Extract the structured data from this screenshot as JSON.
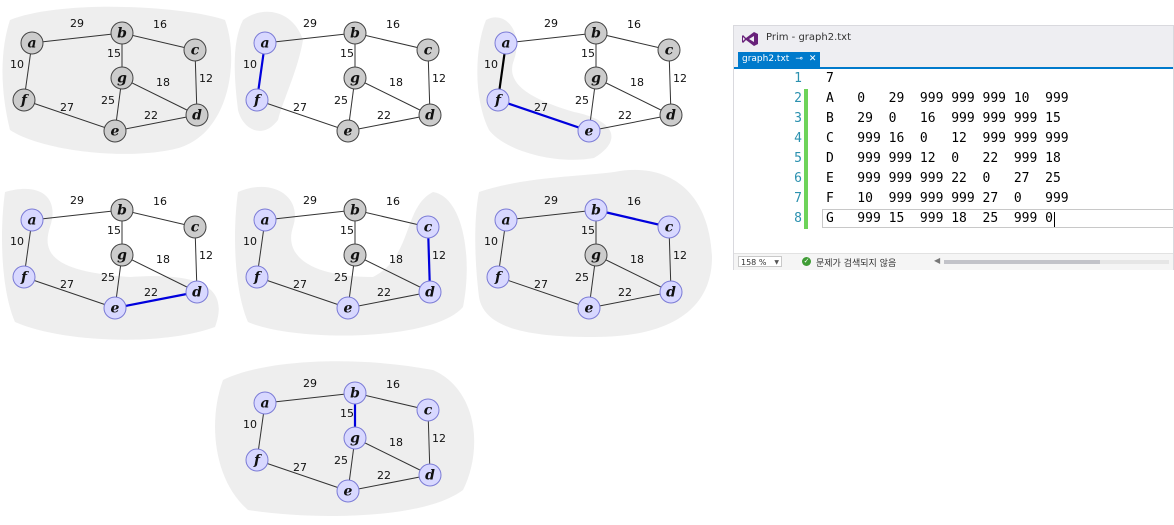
{
  "nodes": [
    {
      "id": "a",
      "label": "a"
    },
    {
      "id": "b",
      "label": "b"
    },
    {
      "id": "c",
      "label": "c"
    },
    {
      "id": "g",
      "label": "g"
    },
    {
      "id": "f",
      "label": "f"
    },
    {
      "id": "e",
      "label": "e"
    },
    {
      "id": "d",
      "label": "d"
    }
  ],
  "edges": [
    {
      "u": "a",
      "v": "b",
      "w": "29"
    },
    {
      "u": "b",
      "v": "c",
      "w": "16"
    },
    {
      "u": "a",
      "v": "f",
      "w": "10"
    },
    {
      "u": "b",
      "v": "g",
      "w": "15"
    },
    {
      "u": "g",
      "v": "d",
      "w": "18"
    },
    {
      "u": "c",
      "v": "d",
      "w": "12"
    },
    {
      "u": "f",
      "v": "e",
      "w": "27"
    },
    {
      "u": "g",
      "v": "e",
      "w": "25"
    },
    {
      "u": "e",
      "v": "d",
      "w": "22"
    }
  ],
  "steps": [
    {
      "visited": [],
      "blue_edges": [],
      "black_edges": []
    },
    {
      "visited": [
        "a",
        "f"
      ],
      "blue_edges": [
        "a-f"
      ],
      "black_edges": []
    },
    {
      "visited": [
        "a",
        "f",
        "e"
      ],
      "blue_edges": [
        "f-e"
      ],
      "black_edges": [
        "a-f"
      ]
    },
    {
      "visited": [
        "a",
        "f",
        "e",
        "d"
      ],
      "blue_edges": [
        "e-d"
      ],
      "black_edges": []
    },
    {
      "visited": [
        "a",
        "f",
        "e",
        "d",
        "c"
      ],
      "blue_edges": [
        "c-d"
      ],
      "black_edges": []
    },
    {
      "visited": [
        "a",
        "f",
        "e",
        "d",
        "c",
        "b"
      ],
      "blue_edges": [
        "b-c"
      ],
      "black_edges": []
    },
    {
      "visited": [
        "a",
        "f",
        "e",
        "d",
        "c",
        "b",
        "g"
      ],
      "blue_edges": [
        "b-g"
      ],
      "black_edges": []
    }
  ],
  "colors": {
    "visited_fill": "#d8d8ff",
    "visited_stroke": "#7b7bd6",
    "unvisited_fill": "#cccccc",
    "unvisited_stroke": "#444444",
    "edge": "#333333",
    "highlight": "#0000dd",
    "blob": "#eeeeee",
    "vs_purple": "#68217a",
    "accent": "#007acc",
    "line_number": "#2b91af",
    "change_marker": "#6ed35a"
  },
  "editor": {
    "title": "Prim - graph2.txt",
    "tab_label": "graph2.txt",
    "tab_pin": "⊸",
    "tab_close": "✕",
    "lines": [
      {
        "num": "1",
        "text": "7"
      },
      {
        "num": "2",
        "text": "A   0   29  999 999 999 10  999"
      },
      {
        "num": "3",
        "text": "B   29  0   16  999 999 999 15"
      },
      {
        "num": "4",
        "text": "C   999 16  0   12  999 999 999"
      },
      {
        "num": "5",
        "text": "D   999 999 12  0   22  999 18"
      },
      {
        "num": "6",
        "text": "E   999 999 999 22  0   27  25"
      },
      {
        "num": "7",
        "text": "F   10  999 999 999 27  0   999"
      },
      {
        "num": "8",
        "text": "G   999 15  999 18  25  999 0"
      }
    ],
    "zoom": "158 %",
    "status": "문제가 검색되지 않음",
    "status_icon": "check-circle-icon"
  }
}
